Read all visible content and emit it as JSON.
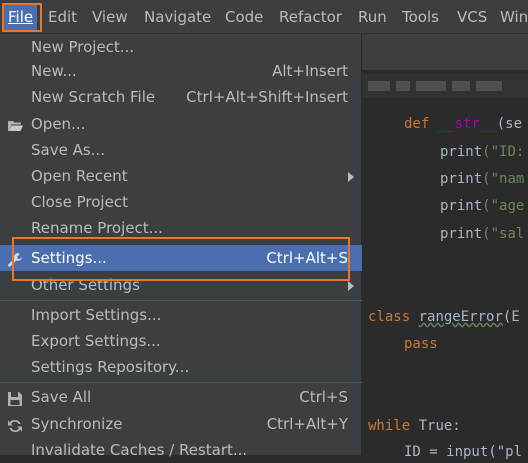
{
  "menubar": {
    "items": [
      {
        "label": "File",
        "mnemonic": "F",
        "active": true
      },
      {
        "label": "Edit"
      },
      {
        "label": "View"
      },
      {
        "label": "Navigate"
      },
      {
        "label": "Code"
      },
      {
        "label": "Refactor"
      },
      {
        "label": "Run"
      },
      {
        "label": "Tools"
      },
      {
        "label": "VCS"
      },
      {
        "label": "Win"
      }
    ]
  },
  "file_menu": {
    "items": [
      {
        "label": "New Project...",
        "shortcut": ""
      },
      {
        "label": "New...",
        "shortcut": "Alt+Insert"
      },
      {
        "label": "New Scratch File",
        "shortcut": "Ctrl+Alt+Shift+Insert"
      },
      {
        "label": "Open...",
        "shortcut": "",
        "icon": "folder-open-icon"
      },
      {
        "label": "Save As...",
        "shortcut": ""
      },
      {
        "label": "Open Recent",
        "shortcut": "",
        "submenu": true
      },
      {
        "label": "Close Project",
        "shortcut": ""
      },
      {
        "label": "Rename Project...",
        "shortcut": ""
      },
      {
        "label": "Settings...",
        "shortcut": "Ctrl+Alt+S",
        "icon": "wrench-icon",
        "selected": true
      },
      {
        "label": "Other Settings",
        "shortcut": "",
        "submenu": true
      },
      {
        "label": "Import Settings...",
        "shortcut": ""
      },
      {
        "label": "Export Settings...",
        "shortcut": ""
      },
      {
        "label": "Settings Repository...",
        "shortcut": ""
      },
      {
        "label": "Save All",
        "shortcut": "Ctrl+S",
        "icon": "save-icon"
      },
      {
        "label": "Synchronize",
        "shortcut": "Ctrl+Alt+Y",
        "icon": "sync-icon"
      },
      {
        "label": "Invalidate Caches / Restart...",
        "shortcut": ""
      }
    ]
  },
  "editor": {
    "lines": [
      {
        "kw": "def",
        "fn": "__str__",
        "rest": "(se"
      },
      {
        "call": "print",
        "rest": "(\"ID:"
      },
      {
        "call": "print",
        "rest": "(\"nam"
      },
      {
        "call": "print",
        "rest": "(\"age"
      },
      {
        "call": "print",
        "rest": "(\"sal"
      },
      {
        "kw": "class",
        "name": "rangeError",
        "rest": "(E"
      },
      {
        "kw": "pass"
      },
      {
        "kw": "while",
        "rest": " True:"
      },
      {
        "id": "ID = input(\"pl"
      }
    ]
  },
  "colors": {
    "menu_bg": "#3c3f41",
    "selection": "#4b6eaf",
    "highlight_border": "#e8772e",
    "keyword": "#cc7832",
    "string": "#6a8759",
    "text": "#bbbbbb"
  }
}
